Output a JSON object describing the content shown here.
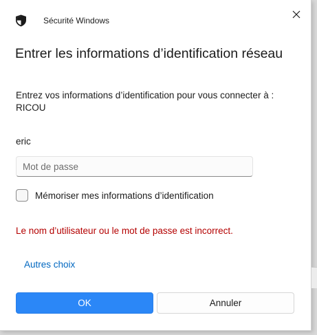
{
  "window": {
    "app_title": "Sécurité Windows",
    "shield_icon": "shield-icon",
    "close_icon": "close-icon"
  },
  "dialog": {
    "heading": "Entrer les informations d’identification réseau",
    "subtitle": "Entrez vos informations d’identification pour vous connecter à : RICOU",
    "username": "eric",
    "password": {
      "value": "",
      "placeholder": "Mot de passe"
    },
    "remember": {
      "label": "Mémoriser mes informations d’identification",
      "checked": false
    },
    "error": "Le nom d’utilisateur ou le mot de passe est incorrect.",
    "more_choices": "Autres choix"
  },
  "buttons": {
    "ok": "OK",
    "cancel": "Annuler"
  },
  "colors": {
    "accent": "#2b87f7",
    "link": "#0067c0",
    "error": "#b40000"
  }
}
